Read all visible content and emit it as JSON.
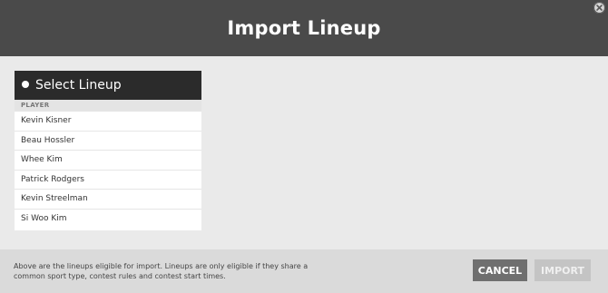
{
  "header": {
    "title": "Import Lineup"
  },
  "lineup_panel": {
    "title": "Select Lineup",
    "column_header": "PLAYER",
    "players": [
      "Kevin Kisner",
      "Beau Hossler",
      "Whee Kim",
      "Patrick Rodgers",
      "Kevin Streelman",
      "Si Woo Kim"
    ]
  },
  "footer": {
    "info_text_line1": "Above are the lineups eligible for import. Lineups are only eligible if they share a",
    "info_text_line2": "common sport type, contest rules and contest start times.",
    "cancel_label": "CANCEL",
    "import_label": "IMPORT"
  },
  "colors": {
    "header_bg": "#4a4a4a",
    "panel_head_bg": "#2b2b2b",
    "cancel_bg": "#6f6f6f",
    "import_disabled_bg": "#c4c4c4"
  },
  "icons": {
    "close": "close-circle-icon"
  }
}
